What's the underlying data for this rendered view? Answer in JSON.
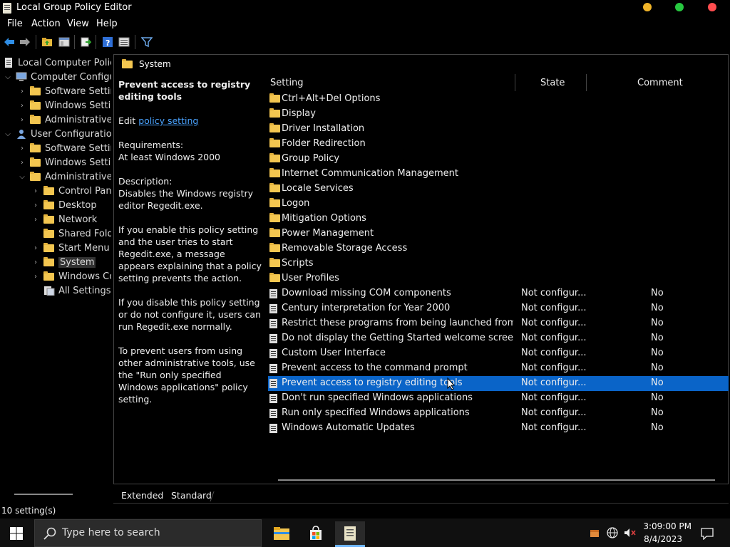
{
  "window": {
    "title": "Local Group Policy Editor",
    "colors": {
      "minimize": "#f0b429",
      "maximize": "#27c840",
      "close": "#ff4d4f"
    }
  },
  "menu": [
    "File",
    "Action",
    "View",
    "Help"
  ],
  "toolbar": {
    "icons": [
      "back-arrow-icon",
      "forward-arrow-icon",
      "folder-up-icon",
      "show-hide-tree-icon",
      "export-list-icon",
      "help-icon",
      "properties-icon",
      "filter-icon"
    ]
  },
  "tree": {
    "root": "Local Computer Policy",
    "computer_config": "Computer Configuration",
    "software_settings": "Software Settings",
    "windows_settings": "Windows Settings",
    "admin_templates": "Administrative Templates",
    "user_config": "User Configuration",
    "user_software_settings": "Software Settings",
    "user_windows_settings": "Windows Settings",
    "user_admin_templates": "Administrative Templates",
    "control_panel": "Control Panel",
    "desktop": "Desktop",
    "network": "Network",
    "shared_folders": "Shared Folders",
    "start_menu": "Start Menu and Taskbar",
    "system": "System",
    "windows_components": "Windows Components",
    "all_settings": "All Settings"
  },
  "breadcrumb": "System",
  "description": {
    "title": "Prevent access to registry editing tools",
    "edit_prefix": "Edit",
    "edit_link": "policy setting",
    "requirements_label": "Requirements:",
    "requirements_value": "At least Windows 2000",
    "description_label": "Description:",
    "description_value": "Disables the Windows registry editor Regedit.exe.",
    "para1": "If you enable this policy setting and the user tries to start Regedit.exe, a message appears explaining that a policy setting prevents the action.",
    "para2": "If you disable this policy setting or do not configure it, users can run Regedit.exe normally.",
    "para3": "To prevent users from using other administrative tools, use the \"Run only specified Windows applications\" policy setting."
  },
  "columns": {
    "setting": "Setting",
    "state": "State",
    "comment": "Comment"
  },
  "folders": [
    "Ctrl+Alt+Del Options",
    "Display",
    "Driver Installation",
    "Folder Redirection",
    "Group Policy",
    "Internet Communication Management",
    "Locale Services",
    "Logon",
    "Mitigation Options",
    "Power Management",
    "Removable Storage Access",
    "Scripts",
    "User Profiles"
  ],
  "policies": [
    {
      "name": "Download missing COM components",
      "state": "Not configur...",
      "comment": "No"
    },
    {
      "name": "Century interpretation for Year 2000",
      "state": "Not configur...",
      "comment": "No"
    },
    {
      "name": "Restrict these programs from being launched from Help",
      "state": "Not configur...",
      "comment": "No"
    },
    {
      "name": "Do not display the Getting Started welcome screen at l...",
      "state": "Not configur...",
      "comment": "No"
    },
    {
      "name": "Custom User Interface",
      "state": "Not configur...",
      "comment": "No"
    },
    {
      "name": "Prevent access to the command prompt",
      "state": "Not configur...",
      "comment": "No"
    },
    {
      "name": "Prevent access to registry editing tools",
      "state": "Not configur...",
      "comment": "No"
    },
    {
      "name": "Don't run specified Windows applications",
      "state": "Not configur...",
      "comment": "No"
    },
    {
      "name": "Run only specified Windows applications",
      "state": "Not configur...",
      "comment": "No"
    },
    {
      "name": "Windows Automatic Updates",
      "state": "Not configur...",
      "comment": "No"
    }
  ],
  "selected_policy": "Prevent access to registry editing tools",
  "tabs": {
    "extended": "Extended",
    "standard": "Standard"
  },
  "status": "10 setting(s)",
  "taskbar": {
    "search_placeholder": "Type here to search",
    "time": "3:09:00 PM",
    "date": "8/4/2023"
  }
}
